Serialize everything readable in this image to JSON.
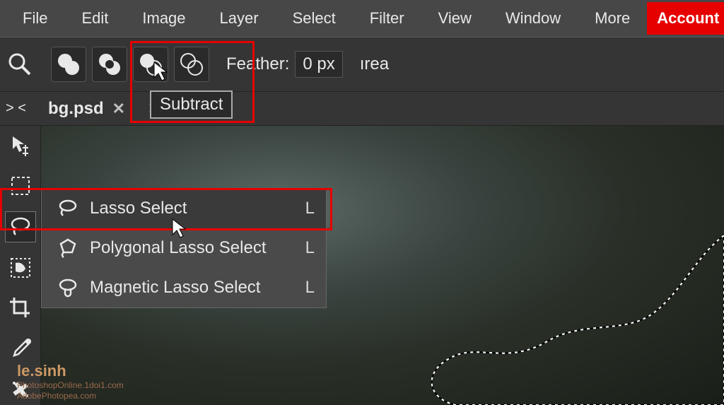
{
  "menubar": {
    "items": [
      "File",
      "Edit",
      "Image",
      "Layer",
      "Select",
      "Filter",
      "View",
      "Window",
      "More"
    ],
    "account_label": "Account"
  },
  "options_bar": {
    "feather_label": "Feather:",
    "feather_value": "0 px",
    "area_text": "ırea",
    "tooltip": "Subtract"
  },
  "tabs": {
    "expand_glyph": "> <",
    "items": [
      {
        "label": "bg.psd",
        "close": "✕"
      }
    ],
    "extra_close": "✕"
  },
  "flyout": {
    "items": [
      {
        "label": "Lasso Select",
        "key": "L"
      },
      {
        "label": "Polygonal Lasso Select",
        "key": "L"
      },
      {
        "label": "Magnetic Lasso Select",
        "key": "L"
      }
    ]
  },
  "watermark": {
    "brand": "le.sinh",
    "line1": "PhotoshopOnline.1doi1.com",
    "line2": "AdobePhotopea.com"
  }
}
